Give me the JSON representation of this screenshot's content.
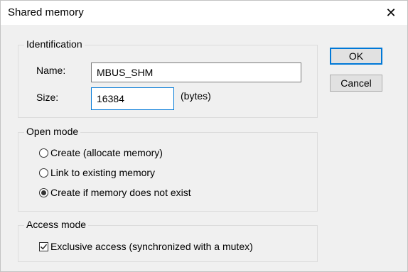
{
  "window": {
    "title": "Shared memory",
    "close_glyph": "✕"
  },
  "identification": {
    "group_label": "Identification",
    "name_label": "Name:",
    "name_value": "MBUS_SHM",
    "size_label": "Size:",
    "size_value": "16384",
    "size_unit": "(bytes)"
  },
  "open_mode": {
    "group_label": "Open mode",
    "options": [
      {
        "label": "Create (allocate memory)",
        "selected": false
      },
      {
        "label": "Link to existing memory",
        "selected": false
      },
      {
        "label": "Create if memory does not exist",
        "selected": true
      }
    ]
  },
  "access_mode": {
    "group_label": "Access mode",
    "exclusive_label": "Exclusive access (synchronized with a mutex)",
    "exclusive_checked": true
  },
  "buttons": {
    "ok_label": "OK",
    "cancel_label": "Cancel"
  },
  "colors": {
    "accent": "#0078d7",
    "dialog_bg": "#f0f0f0"
  }
}
